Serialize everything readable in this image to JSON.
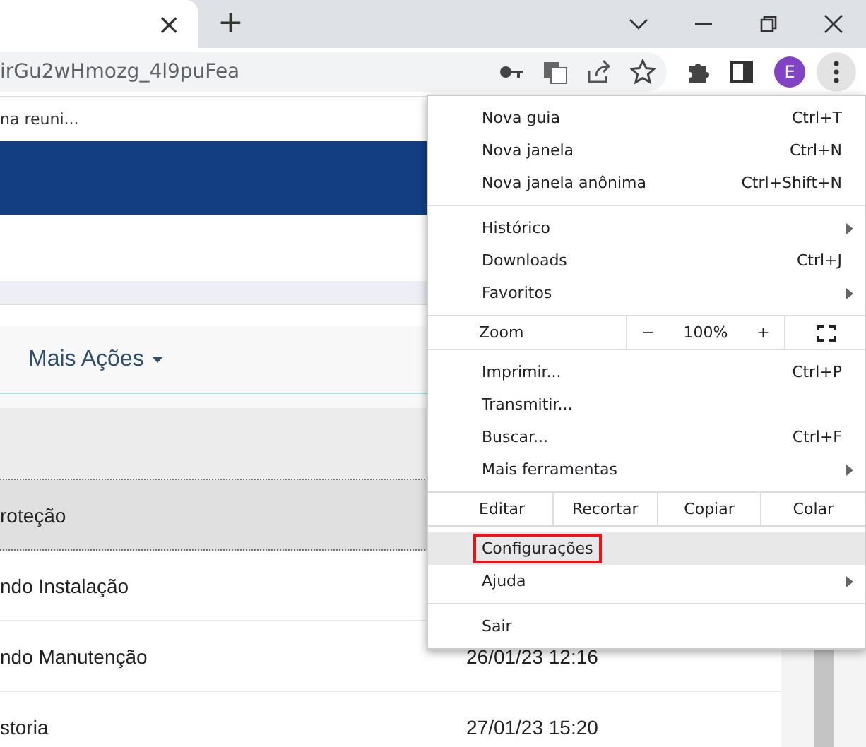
{
  "tab": {
    "close": "×",
    "new_tab": "+"
  },
  "address_bar": {
    "url": "irGu2wHmozg_4l9puFea"
  },
  "profile": {
    "initial": "E"
  },
  "bookmarks": [
    "na reuni..."
  ],
  "page": {
    "more_actions": "Mais Ações",
    "rows": [
      {
        "title": "roteção",
        "date": "",
        "selected": true
      },
      {
        "title": "ndo Instalação",
        "date": "",
        "selected": false
      },
      {
        "title": "ndo Manutenção",
        "date": "26/01/23 12:16",
        "selected": false
      },
      {
        "title": "storia",
        "date": "27/01/23 15:20",
        "selected": false
      }
    ]
  },
  "menu": [
    {
      "kind": "item",
      "label": "Nova guia",
      "shortcut": "Ctrl+T",
      "submenu": false,
      "selected": false,
      "outlined": false
    },
    {
      "kind": "item",
      "label": "Nova janela",
      "shortcut": "Ctrl+N",
      "submenu": false,
      "selected": false,
      "outlined": false
    },
    {
      "kind": "item",
      "label": "Nova janela anônima",
      "shortcut": "Ctrl+Shift+N",
      "submenu": false,
      "selected": false,
      "outlined": false
    },
    {
      "kind": "separator"
    },
    {
      "kind": "item",
      "label": "Histórico",
      "submenu": true,
      "selected": false,
      "outlined": false
    },
    {
      "kind": "item",
      "label": "Downloads",
      "shortcut": "Ctrl+J",
      "submenu": false,
      "selected": false,
      "outlined": false
    },
    {
      "kind": "item",
      "label": "Favoritos",
      "submenu": true,
      "selected": false,
      "outlined": false
    },
    {
      "kind": "zoom",
      "label": "Zoom",
      "minus": "−",
      "value": "100%",
      "plus": "+"
    },
    {
      "kind": "item",
      "label": "Imprimir...",
      "shortcut": "Ctrl+P",
      "submenu": false,
      "selected": false,
      "outlined": false
    },
    {
      "kind": "item",
      "label": "Transmitir...",
      "submenu": false,
      "selected": false,
      "outlined": false
    },
    {
      "kind": "item",
      "label": "Buscar...",
      "shortcut": "Ctrl+F",
      "submenu": false,
      "selected": false,
      "outlined": false
    },
    {
      "kind": "item",
      "label": "Mais ferramentas",
      "submenu": true,
      "selected": false,
      "outlined": false
    },
    {
      "kind": "edit",
      "label": "Editar",
      "buttons": [
        "Recortar",
        "Copiar",
        "Colar"
      ]
    },
    {
      "kind": "item",
      "label": "Configurações",
      "submenu": false,
      "selected": true,
      "outlined": true
    },
    {
      "kind": "item",
      "label": "Ajuda",
      "submenu": true,
      "selected": false,
      "outlined": false
    },
    {
      "kind": "separator"
    },
    {
      "kind": "item",
      "label": "Sair",
      "submenu": false,
      "selected": false,
      "outlined": false
    }
  ]
}
